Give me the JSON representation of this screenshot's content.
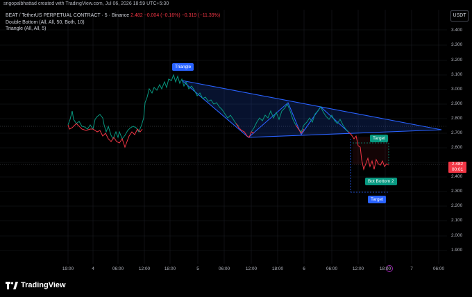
{
  "header": {
    "credit": "srigopalbhattad created with TradingView.com, Jul 06, 2026 18:59 UTC+5:30"
  },
  "legend": {
    "symbol": "BEAT / TetherUS PERPETUAL CONTRACT · 5 · Binance",
    "price": "2.482",
    "change": "−0.004 (−0.16%)",
    "change2": "−0.319 (−11.39%)",
    "indicator1": "Double Bottom (All, All, 50, Both, 10)",
    "indicator2": "Triangle (All, All, 5)"
  },
  "axis": {
    "currency": "USDT",
    "y_ticks": [
      "3.400",
      "3.300",
      "3.200",
      "3.100",
      "3.000",
      "2.900",
      "2.800",
      "2.700",
      "2.600",
      "2.500",
      "2.400",
      "2.300",
      "2.200",
      "2.100",
      "2.000",
      "1.900"
    ],
    "x_ticks": [
      "19:00",
      "4",
      "06:00",
      "12:00",
      "18:00",
      "5",
      "06:00",
      "12:00",
      "18:00",
      "6",
      "06:00",
      "12:00",
      "18:00",
      "7",
      "06:00"
    ]
  },
  "price_tag": {
    "price": "2.482",
    "countdown": "00:01"
  },
  "annotations": {
    "triangle": "Triangle",
    "target_top": "Target",
    "double_bottom": "Bot  Bottom 2",
    "target_bottom": "Target"
  },
  "footer": {
    "brand": "TradingView"
  },
  "colors": {
    "up": "#089981",
    "down": "#f23645",
    "pattern": "#2962ff",
    "background": "#000000"
  }
}
